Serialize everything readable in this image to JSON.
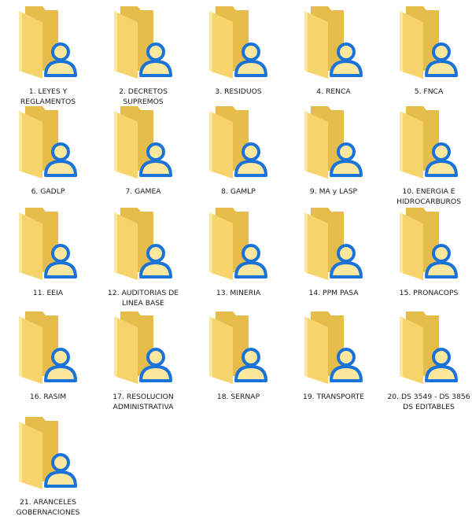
{
  "window": {
    "view": "large-icons",
    "folder_icon": "shared-user-folder-icon"
  },
  "colors": {
    "background": "#ffffff",
    "folder_back": "#e6bc4b",
    "folder_front": "#f7d36b",
    "folder_light": "#fce79f",
    "overlay_blue": "#1a73d9",
    "text": "#1b1b1b"
  },
  "folders": [
    {
      "label": "1. LEYES Y REGLAMENTOS"
    },
    {
      "label": "2. DECRETOS SUPREMOS"
    },
    {
      "label": "3. RESIDUOS"
    },
    {
      "label": "4. RENCA"
    },
    {
      "label": "5. FNCA"
    },
    {
      "label": "6. GADLP"
    },
    {
      "label": "7. GAMEA"
    },
    {
      "label": "8. GAMLP"
    },
    {
      "label": "9. MA y LASP"
    },
    {
      "label": "10. ENERGIA E HIDROCARBUROS"
    },
    {
      "label": "11. EEIA"
    },
    {
      "label": "12. AUDITORIAS DE LINEA BASE"
    },
    {
      "label": "13. MINERIA"
    },
    {
      "label": "14. PPM PASA"
    },
    {
      "label": "15. PRONACOPS"
    },
    {
      "label": "16. RASIM"
    },
    {
      "label": "17. RESOLUCION ADMINISTRATIVA"
    },
    {
      "label": "18. SERNAP"
    },
    {
      "label": "19. TRANSPORTE"
    },
    {
      "label": "20. DS 3549 - DS 3856 DS EDITABLES"
    },
    {
      "label": "21. ARANCELES GOBERNACIONES"
    }
  ]
}
